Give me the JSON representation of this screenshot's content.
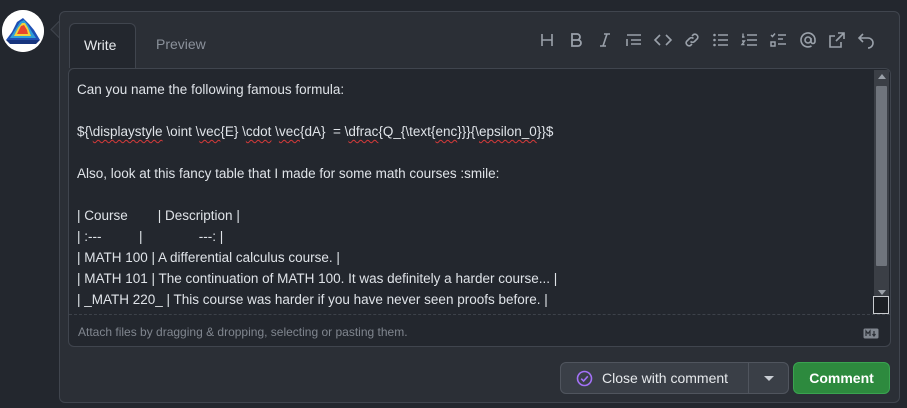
{
  "tabs": [
    {
      "label": "Write"
    },
    {
      "label": "Preview"
    }
  ],
  "toolbar": {
    "icons": [
      "heading-icon",
      "bold-icon",
      "italic-icon",
      "quote-icon",
      "code-icon",
      "link-icon",
      "bulleted-list-icon",
      "numbered-list-icon",
      "task-list-icon",
      "mention-icon",
      "reference-icon",
      "undo-icon"
    ]
  },
  "editor": {
    "lines": [
      "Can you name the following famous formula:",
      "",
      "${\\displaystyle \\oint \\vec{E} \\cdot \\vec{dA}  = \\dfrac{Q_{\\text{enc}}}{\\epsilon_0}}$",
      "",
      "Also, look at this fancy table that I made for some math courses :smile:",
      "",
      "| Course        | Description |",
      "| :---          |               ---: |",
      "| MATH 100 | A differential calculus course. |",
      "| MATH 101 | The continuation of MATH 100. It was definitely a harder course... |",
      "| _MATH 220_ | This course was harder if you have never seen proofs before. |"
    ],
    "attach_hint": "Attach files by dragging & dropping, selecting or pasting them."
  },
  "actions": {
    "close_label": "Close with comment",
    "comment_label": "Comment"
  },
  "colors": {
    "background": "#23272e",
    "panel": "#2b2f36",
    "comment_green": "#2d8a3e",
    "close_icon": "#a371f7"
  }
}
